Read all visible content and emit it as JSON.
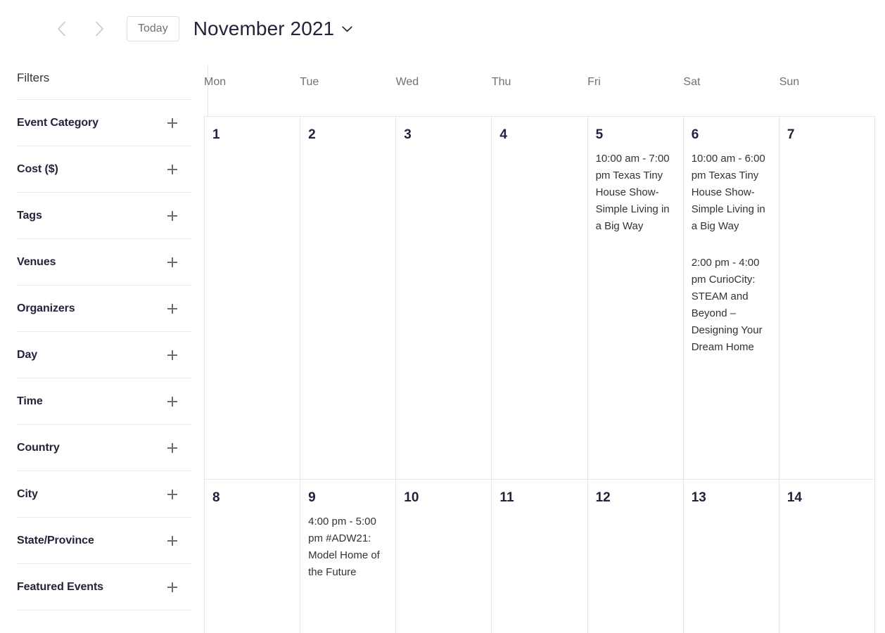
{
  "toolbar": {
    "prev_icon": "chevron-left-icon",
    "next_icon": "chevron-right-icon",
    "today_label": "Today",
    "title": "November 2021",
    "title_caret_icon": "chevron-down-icon"
  },
  "sidebar": {
    "title": "Filters",
    "expand_icon": "plus-icon",
    "items": [
      {
        "label": "Event Category"
      },
      {
        "label": "Cost ($)"
      },
      {
        "label": "Tags"
      },
      {
        "label": "Venues"
      },
      {
        "label": "Organizers"
      },
      {
        "label": "Day"
      },
      {
        "label": "Time"
      },
      {
        "label": "Country"
      },
      {
        "label": "City"
      },
      {
        "label": "State/Province"
      },
      {
        "label": "Featured Events"
      }
    ]
  },
  "calendar": {
    "weekdays": [
      "Mon",
      "Tue",
      "Wed",
      "Thu",
      "Fri",
      "Sat",
      "Sun"
    ],
    "weeks": [
      {
        "days": [
          {
            "num": "1",
            "events": []
          },
          {
            "num": "2",
            "events": []
          },
          {
            "num": "3",
            "events": []
          },
          {
            "num": "4",
            "events": []
          },
          {
            "num": "5",
            "events": [
              {
                "text": "10:00 am - 7:00 pm Texas Tiny House Show-Simple Living in a Big Way"
              }
            ]
          },
          {
            "num": "6",
            "events": [
              {
                "text": "10:00 am - 6:00 pm Texas Tiny House Show-Simple Living in a Big Way"
              },
              {
                "text": "2:00 pm - 4:00 pm CurioCity: STEAM and Beyond – Designing Your Dream Home"
              }
            ]
          },
          {
            "num": "7",
            "events": []
          }
        ]
      },
      {
        "days": [
          {
            "num": "8",
            "events": []
          },
          {
            "num": "9",
            "events": [
              {
                "text": "4:00 pm - 5:00 pm #ADW21: Model Home of the Future"
              }
            ]
          },
          {
            "num": "10",
            "events": []
          },
          {
            "num": "11",
            "events": []
          },
          {
            "num": "12",
            "events": []
          },
          {
            "num": "13",
            "events": []
          },
          {
            "num": "14",
            "events": []
          }
        ]
      }
    ]
  },
  "colors": {
    "text_dark": "#21243a",
    "text_muted": "#6d7278",
    "border": "#e4e6e8",
    "arrow_gray": "#c9ccd1"
  }
}
